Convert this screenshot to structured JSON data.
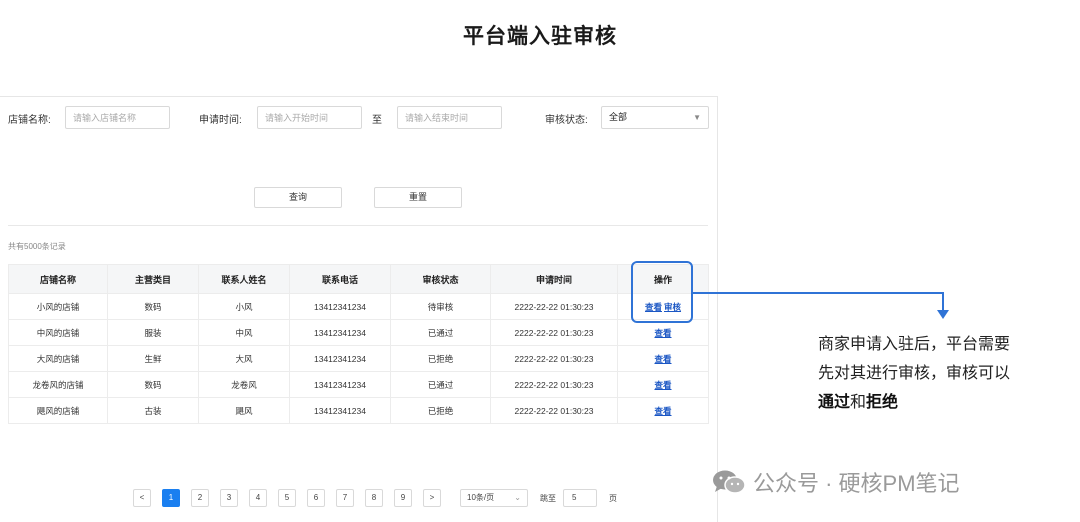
{
  "page_title": "平台端入驻审核",
  "filters": {
    "store_name_label": "店铺名称:",
    "store_name_placeholder": "请输入店铺名称",
    "apply_time_label": "申请时间:",
    "start_placeholder": "请输入开始时间",
    "to_label": "至",
    "end_placeholder": "请输入结束时间",
    "status_label": "审核状态:",
    "status_value": "全部"
  },
  "buttons": {
    "query": "查询",
    "reset": "重置"
  },
  "record_count": "共有5000条记录",
  "table": {
    "headers": [
      "店铺名称",
      "主营类目",
      "联系人姓名",
      "联系电话",
      "审核状态",
      "申请时间",
      "操作"
    ],
    "rows": [
      {
        "store": "小风的店铺",
        "category": "数码",
        "contact": "小风",
        "phone": "13412341234",
        "status": "待审核",
        "time": "2222-22-22 01:30:23",
        "ops": [
          "查看",
          "审核"
        ]
      },
      {
        "store": "中风的店铺",
        "category": "服装",
        "contact": "中风",
        "phone": "13412341234",
        "status": "已通过",
        "time": "2222-22-22 01:30:23",
        "ops": [
          "查看"
        ]
      },
      {
        "store": "大风的店铺",
        "category": "生鲜",
        "contact": "大风",
        "phone": "13412341234",
        "status": "已拒绝",
        "time": "2222-22-22 01:30:23",
        "ops": [
          "查看"
        ]
      },
      {
        "store": "龙卷风的店铺",
        "category": "数码",
        "contact": "龙卷风",
        "phone": "13412341234",
        "status": "已通过",
        "time": "2222-22-22 01:30:23",
        "ops": [
          "查看"
        ]
      },
      {
        "store": "飓风的店铺",
        "category": "古装",
        "contact": "飓风",
        "phone": "13412341234",
        "status": "已拒绝",
        "time": "2222-22-22 01:30:23",
        "ops": [
          "查看"
        ]
      }
    ]
  },
  "annotation": {
    "line1": "商家申请入驻后，平台需要",
    "line2": "先对其进行审核，审核可以",
    "approve": "通过",
    "and": "和",
    "reject": "拒绝"
  },
  "watermark": "公众号 · 硬核PM笔记",
  "pagination": {
    "prev": "<",
    "pages": [
      "1",
      "2",
      "3",
      "4",
      "5",
      "6",
      "7",
      "8",
      "9"
    ],
    "current": "1",
    "next": ">",
    "page_size": "10条/页",
    "jump_label": "跳至",
    "jump_value": "5",
    "page_suffix": "页"
  },
  "colors": {
    "accent": "#2f73d6",
    "link": "#1a56c4",
    "active_page": "#1a7ff0"
  }
}
